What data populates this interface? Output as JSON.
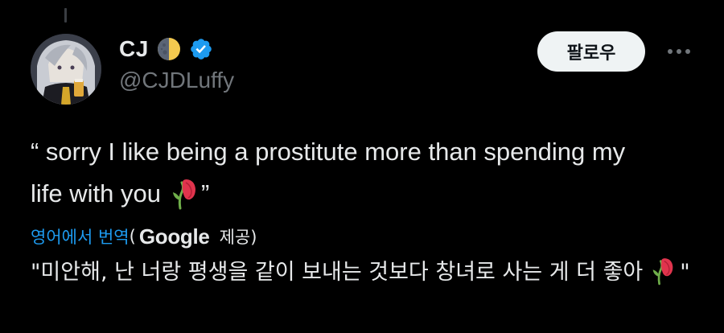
{
  "author": {
    "display_name": "CJ",
    "handle": "@CJDLuffy",
    "badge_icon": "half-moon-icon",
    "verified_icon": "verified-badge-icon",
    "verified_color": "#1d9bf0"
  },
  "actions": {
    "follow_label": "팔로우",
    "more_icon": "more-options-icon"
  },
  "tweet": {
    "text": "“ sorry I like being a prostitute more than spending my life with you",
    "closing_quote": "”",
    "emoji": "wilted-flower-emoji"
  },
  "translation": {
    "link_label": "영어에서 번역",
    "open_paren": "(",
    "provider": "Google",
    "provided_suffix": "제공)",
    "text": "\"미안해, 난 너랑 평생을 같이 보내는 것보다 창녀로 사는 게 더 좋아",
    "closing_quote": "\"",
    "link_color": "#1d9bf0"
  },
  "theme": {
    "background": "#000000",
    "text": "#e7e9ea",
    "muted": "#71767b",
    "button_bg": "#eff3f4"
  }
}
